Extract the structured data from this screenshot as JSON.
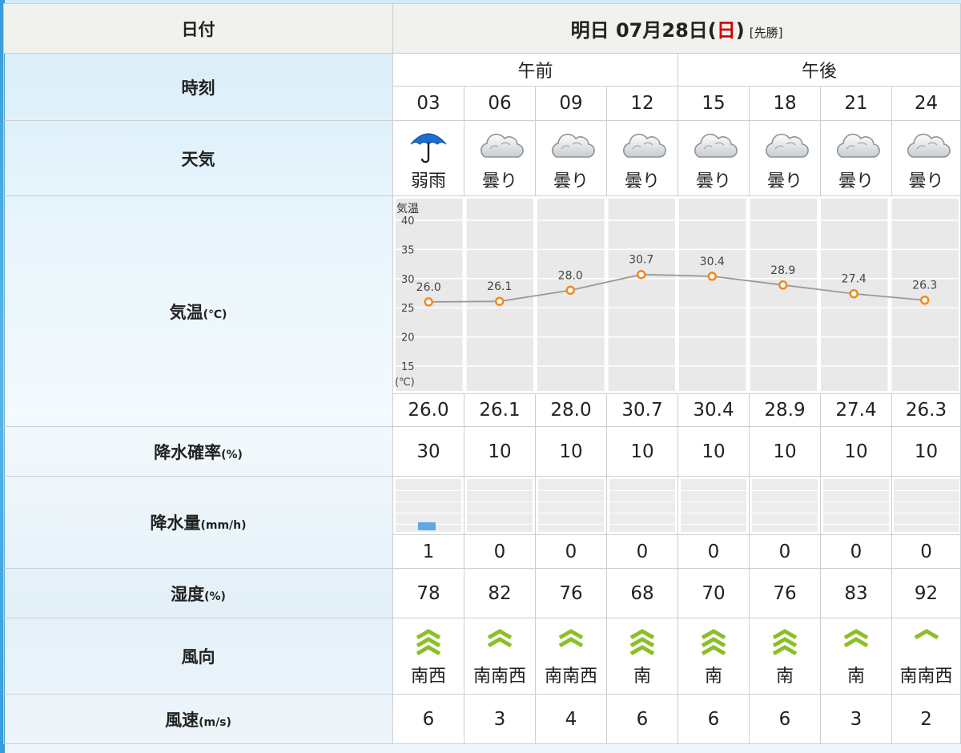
{
  "labels": {
    "date": "日付",
    "time": "時刻",
    "weather": "天気",
    "temp": "気温",
    "temp_unit": "(℃)",
    "precip_prob": "降水確率",
    "precip_prob_unit": "(%)",
    "precip_amt": "降水量",
    "precip_amt_unit": "(mm/h)",
    "humidity": "湿度",
    "humidity_unit": "(%)",
    "wind_dir": "風向",
    "wind_speed": "風速",
    "wind_speed_unit": "(m/s)"
  },
  "date": {
    "prefix": "明日 07月28日(",
    "weekday": "日",
    "suffix": ")",
    "tag": "[先勝]"
  },
  "halves": [
    "午前",
    "午後"
  ],
  "hours": [
    "03",
    "06",
    "09",
    "12",
    "15",
    "18",
    "21",
    "24"
  ],
  "weather": [
    {
      "icon": "umbrella-icon",
      "text": "弱雨"
    },
    {
      "icon": "cloud-icon",
      "text": "曇り"
    },
    {
      "icon": "cloud-icon",
      "text": "曇り"
    },
    {
      "icon": "cloud-icon",
      "text": "曇り"
    },
    {
      "icon": "cloud-icon",
      "text": "曇り"
    },
    {
      "icon": "cloud-icon",
      "text": "曇り"
    },
    {
      "icon": "cloud-icon",
      "text": "曇り"
    },
    {
      "icon": "cloud-icon",
      "text": "曇り"
    }
  ],
  "temps": [
    "26.0",
    "26.1",
    "28.0",
    "30.7",
    "30.4",
    "28.9",
    "27.4",
    "26.3"
  ],
  "precip_prob": [
    "30",
    "10",
    "10",
    "10",
    "10",
    "10",
    "10",
    "10"
  ],
  "precip_amt": [
    "1",
    "0",
    "0",
    "0",
    "0",
    "0",
    "0",
    "0"
  ],
  "humidity": [
    "78",
    "82",
    "76",
    "68",
    "70",
    "76",
    "83",
    "92"
  ],
  "wind_dir": [
    "南西",
    "南南西",
    "南南西",
    "南",
    "南",
    "南",
    "南",
    "南南西"
  ],
  "wind_strength": [
    3,
    2,
    2,
    3,
    3,
    3,
    2,
    1
  ],
  "wind_speed": [
    "6",
    "3",
    "4",
    "6",
    "6",
    "6",
    "3",
    "2"
  ],
  "chart_data": {
    "type": "line",
    "title": "気温",
    "ylabel": "(℃)",
    "ylim": [
      15,
      40
    ],
    "yticks": [
      "40",
      "35",
      "30",
      "25",
      "20",
      "15"
    ],
    "x": [
      "03",
      "06",
      "09",
      "12",
      "15",
      "18",
      "21",
      "24"
    ],
    "values": [
      26.0,
      26.1,
      28.0,
      30.7,
      30.4,
      28.9,
      27.4,
      26.3
    ],
    "value_labels": [
      "26.0",
      "26.1",
      "28.0",
      "30.7",
      "30.4",
      "28.9",
      "27.4",
      "26.3"
    ],
    "grid": true,
    "colors": {
      "line": "#999999",
      "marker": "#f08a1c"
    }
  },
  "colors": {
    "sunday": "#d40000",
    "rain_bar": "#5fa7e8",
    "wind_arrow": "#8cbf26"
  }
}
